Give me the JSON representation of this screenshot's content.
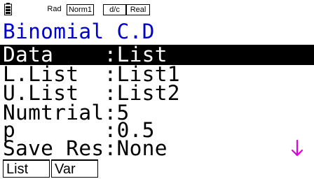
{
  "status_bar": {
    "icon": "battery-icon",
    "angle_badge": "Rad",
    "display_badge": "Norm1",
    "fraction_badge": "d/c",
    "complex_badge": "Real"
  },
  "title": "Binomial C.D",
  "rows": [
    {
      "label": "Data",
      "separator": ":",
      "value": "List",
      "selected": true
    },
    {
      "label": "L.List",
      "separator": ":",
      "value": "List1"
    },
    {
      "label": "U.List",
      "separator": ":",
      "value": "List2"
    },
    {
      "label": "Numtrial",
      "separator": ":",
      "value": "5"
    },
    {
      "label": "p",
      "separator": ":",
      "value": "0.5"
    },
    {
      "label": "Save Res",
      "separator": ":",
      "value": "None"
    }
  ],
  "scroll_indicator": {
    "icon": "scroll-down-arrow-icon",
    "color": "#e000e0"
  },
  "function_keys": [
    {
      "label": "List"
    },
    {
      "label": "Var"
    }
  ],
  "colors": {
    "title": "#0000d0",
    "highlight_bg": "#000000",
    "highlight_fg": "#ffffff"
  }
}
